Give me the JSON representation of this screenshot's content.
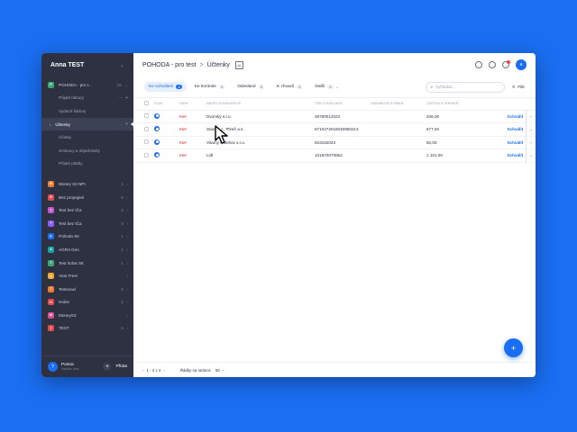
{
  "sidebar": {
    "user_name": "Anna TEST",
    "companies": [
      {
        "label": "POHODA - pro t...",
        "count": "16",
        "badge": "P",
        "color": "#3aa876",
        "expanded": true
      },
      {
        "label": "Money S3 NPI",
        "count": "1",
        "badge": "M",
        "color": "#f07b2f"
      },
      {
        "label": "Bez propojení",
        "count": "8",
        "badge": "B",
        "color": "#e5484d"
      },
      {
        "label": "Test bez IČa",
        "count": "3",
        "badge": "T",
        "color": "#c259c9"
      },
      {
        "label": "Test bez IČa",
        "count": "3",
        "badge": "T",
        "color": "#8b5cf6"
      },
      {
        "label": "Pohoda SK",
        "count": "1",
        "badge": "P",
        "color": "#1a6ef2"
      },
      {
        "label": "AGRA Gen",
        "count": "4",
        "badge": "A",
        "color": "#14a3a3"
      },
      {
        "label": "Test holos SK",
        "count": "1",
        "badge": "T",
        "color": "#3aa876"
      },
      {
        "label": "Atos Free!",
        "count": "",
        "badge": "A",
        "color": "#f2a82f"
      },
      {
        "label": "Testovací",
        "count": "3",
        "badge": "T",
        "color": "#f07b2f"
      },
      {
        "label": "Holos",
        "count": "4",
        "badge": "H",
        "color": "#e5484d"
      },
      {
        "label": "MoneyS3",
        "count": "",
        "badge": "M",
        "color": "#d94f8a"
      },
      {
        "label": "TEST",
        "count": "5",
        "badge": "T",
        "color": "#e5484d"
      }
    ],
    "sub_items": [
      {
        "label": "Přijaté faktury",
        "count": "16"
      },
      {
        "label": "Vydané faktury",
        "count": ""
      },
      {
        "label": "Účtenky",
        "count": "",
        "active": true
      },
      {
        "label": "Účetky",
        "count": ""
      },
      {
        "label": "Smlouvy a objednávky",
        "count": ""
      },
      {
        "label": "Přijaté platby",
        "count": ""
      }
    ],
    "help_label": "Pomoc",
    "help_sub": "Napište nám",
    "add_label": "Přidat"
  },
  "topbar": {
    "crumb_company": "POHODA - pro test",
    "crumb_sep": ">",
    "crumb_page": "Účtenky",
    "avatar_letter": "a"
  },
  "tabs": [
    {
      "label": "Ke schválení",
      "count": "4",
      "active": true
    },
    {
      "label": "Ke kontrole",
      "count": "0"
    },
    {
      "label": "Odeslané",
      "count": "0"
    },
    {
      "label": "K chvacli",
      "count": "0"
    },
    {
      "label": "Další",
      "count": "4",
      "dropdown": true
    }
  ],
  "search": {
    "placeholder": "Vyhledat..."
  },
  "filter_label": "Filtr",
  "table": {
    "columns": [
      "STAV",
      "DATA",
      "NÁZEV DODAVATELE",
      "ČÍSLO DOKLADU",
      "VARIABILNÍ SYMBOL",
      "ČÁSTKA K ÚHRADĚ"
    ],
    "rows": [
      {
        "supplier": "Dvorský s.r.o.",
        "doc_number": "28750012023",
        "vs": "",
        "amount": "208,00",
        "action": "Schválit"
      },
      {
        "supplier": "Stavby J.. Plzeň a.s.",
        "doc_number": "6710472016040950213",
        "vs": "",
        "amount": "677,94",
        "action": "Schválit"
      },
      {
        "supplier": "Vitamy Holešov s.r.o.",
        "doc_number": "923182023",
        "vs": "",
        "amount": "50,00",
        "action": "Schválit"
      },
      {
        "supplier": "Lidl",
        "doc_number": "101870070062",
        "vs": "",
        "amount": "1 101,00",
        "action": "Schválit"
      }
    ],
    "file_badge": "PDF"
  },
  "footer": {
    "range": "1 - 4 z 4",
    "rows_label": "Řádky na stránce",
    "rows_value": "50"
  },
  "fab_label": "+",
  "colors": {
    "accent": "#1a6ef2",
    "sidebar": "#2d3142",
    "background": "#1a6ef2"
  }
}
